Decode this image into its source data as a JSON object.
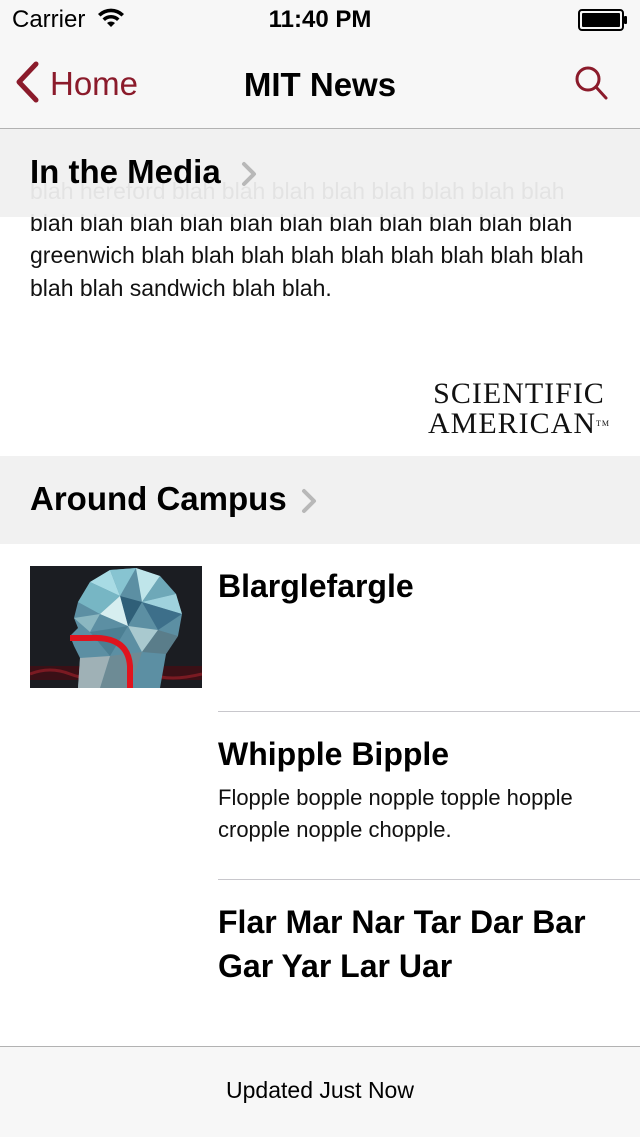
{
  "status_bar": {
    "carrier": "Carrier",
    "time": "11:40 PM"
  },
  "nav": {
    "back_label": "Home",
    "title": "MIT News",
    "accent_color": "#8b1b2b"
  },
  "in_the_media": {
    "header": "In the Media",
    "text": "blah hereford blah blah blah blah blah blah blah blah blah blah blah blah blah blah blah blah blah blah blah greenwich blah blah blah blah blah blah blah blah blah blah blah sandwich blah blah.",
    "source_logo_line1": "SCIENTIFIC",
    "source_logo_line2": "AMERICAN",
    "source_logo_tm": "TM"
  },
  "around_campus": {
    "header": "Around Campus",
    "stories": [
      {
        "title": "Blarglefargle",
        "body": ""
      },
      {
        "title": "Whipple Bipple",
        "body": "Flopple bopple nopple topple hopple cropple nopple chopple."
      },
      {
        "title": "Flar Mar Nar Tar Dar Bar Gar Yar Lar Uar",
        "body": ""
      }
    ]
  },
  "toolbar": {
    "status": "Updated Just Now"
  }
}
